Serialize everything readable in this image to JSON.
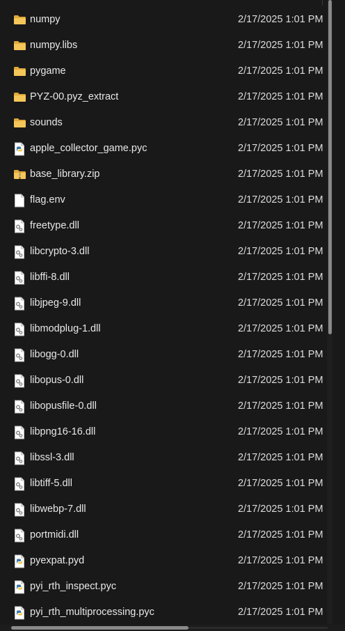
{
  "files": [
    {
      "name": "numpy",
      "date": "2/17/2025 1:01 PM",
      "icon": "folder-icon"
    },
    {
      "name": "numpy.libs",
      "date": "2/17/2025 1:01 PM",
      "icon": "folder-icon"
    },
    {
      "name": "pygame",
      "date": "2/17/2025 1:01 PM",
      "icon": "folder-icon"
    },
    {
      "name": "PYZ-00.pyz_extract",
      "date": "2/17/2025 1:01 PM",
      "icon": "folder-icon"
    },
    {
      "name": "sounds",
      "date": "2/17/2025 1:01 PM",
      "icon": "folder-icon"
    },
    {
      "name": "apple_collector_game.pyc",
      "date": "2/17/2025 1:01 PM",
      "icon": "python-file-icon"
    },
    {
      "name": "base_library.zip",
      "date": "2/17/2025 1:01 PM",
      "icon": "zip-folder-icon"
    },
    {
      "name": "flag.env",
      "date": "2/17/2025 1:01 PM",
      "icon": "blank-file-icon"
    },
    {
      "name": "freetype.dll",
      "date": "2/17/2025 1:01 PM",
      "icon": "dll-file-icon"
    },
    {
      "name": "libcrypto-3.dll",
      "date": "2/17/2025 1:01 PM",
      "icon": "dll-file-icon"
    },
    {
      "name": "libffi-8.dll",
      "date": "2/17/2025 1:01 PM",
      "icon": "dll-file-icon"
    },
    {
      "name": "libjpeg-9.dll",
      "date": "2/17/2025 1:01 PM",
      "icon": "dll-file-icon"
    },
    {
      "name": "libmodplug-1.dll",
      "date": "2/17/2025 1:01 PM",
      "icon": "dll-file-icon"
    },
    {
      "name": "libogg-0.dll",
      "date": "2/17/2025 1:01 PM",
      "icon": "dll-file-icon"
    },
    {
      "name": "libopus-0.dll",
      "date": "2/17/2025 1:01 PM",
      "icon": "dll-file-icon"
    },
    {
      "name": "libopusfile-0.dll",
      "date": "2/17/2025 1:01 PM",
      "icon": "dll-file-icon"
    },
    {
      "name": "libpng16-16.dll",
      "date": "2/17/2025 1:01 PM",
      "icon": "dll-file-icon"
    },
    {
      "name": "libssl-3.dll",
      "date": "2/17/2025 1:01 PM",
      "icon": "dll-file-icon"
    },
    {
      "name": "libtiff-5.dll",
      "date": "2/17/2025 1:01 PM",
      "icon": "dll-file-icon"
    },
    {
      "name": "libwebp-7.dll",
      "date": "2/17/2025 1:01 PM",
      "icon": "dll-file-icon"
    },
    {
      "name": "portmidi.dll",
      "date": "2/17/2025 1:01 PM",
      "icon": "dll-file-icon"
    },
    {
      "name": "pyexpat.pyd",
      "date": "2/17/2025 1:01 PM",
      "icon": "python-file-icon"
    },
    {
      "name": "pyi_rth_inspect.pyc",
      "date": "2/17/2025 1:01 PM",
      "icon": "python-file-icon"
    },
    {
      "name": "pyi_rth_multiprocessing.pyc",
      "date": "2/17/2025 1:01 PM",
      "icon": "python-file-icon"
    }
  ],
  "colors": {
    "background": "#191919",
    "folder": "#f2c14e",
    "text": "#e8e8e8",
    "scrollbar_thumb": "#8a8a8a"
  }
}
